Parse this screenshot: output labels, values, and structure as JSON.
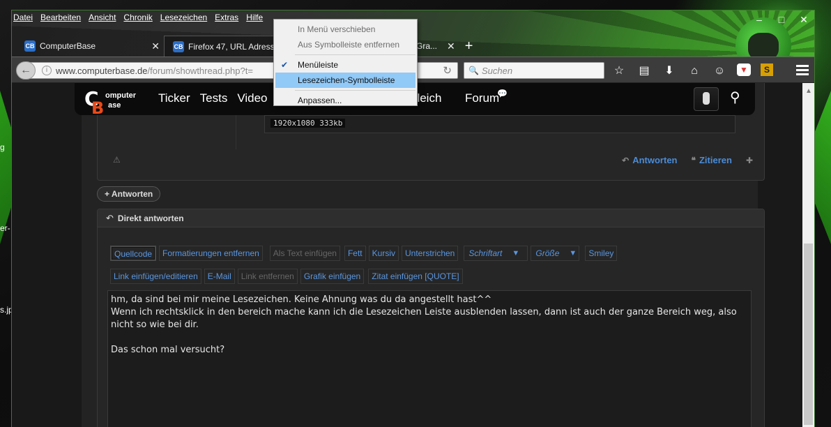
{
  "desktop": {
    "labels": [
      "g",
      "er-",
      "s.jp"
    ]
  },
  "menubar": {
    "items": [
      {
        "label": "Datei",
        "accesskey": "D"
      },
      {
        "label": "Bearbeiten",
        "accesskey": "B"
      },
      {
        "label": "Ansicht",
        "accesskey": "A"
      },
      {
        "label": "Chronik",
        "accesskey": "C"
      },
      {
        "label": "Lesezeichen",
        "accesskey": "L"
      },
      {
        "label": "Extras",
        "accesskey": "E"
      },
      {
        "label": "Hilfe",
        "accesskey": "H"
      }
    ]
  },
  "tabs": [
    {
      "title": "ComputerBase",
      "favicon": "CB"
    },
    {
      "title": "Firefox 47, URL Adressl",
      "favicon": "CB"
    },
    {
      "title": "-Gra..."
    }
  ],
  "window_controls": {
    "minimize": "–",
    "maximize": "□",
    "close": "✕"
  },
  "navbar": {
    "url_host": "www.computerbase.de",
    "url_path": "/forum/showthread.php?t=",
    "search_placeholder": "Suchen",
    "toolbar_icons": [
      "star-icon",
      "reading-list-icon",
      "download-icon",
      "home-icon",
      "emoji-icon",
      "pocket-icon",
      "extension-icon"
    ],
    "extension_label": "S"
  },
  "context_menu": {
    "items": [
      {
        "label": "In Menü verschieben",
        "disabled": true
      },
      {
        "label": "Aus Symbolleiste entfernen",
        "disabled": true
      },
      {
        "label": "Menüleiste",
        "checked": true
      },
      {
        "label": "Lesezeichen-Symbolleiste",
        "highlighted": true
      },
      {
        "label": "Anpassen..."
      }
    ]
  },
  "site": {
    "logo_line1": "omputer",
    "logo_line2": "ase",
    "logo_c": "C",
    "logo_b": "B",
    "nav": [
      "Ticker",
      "Tests",
      "Video"
    ],
    "nav_vergleich": "gleich",
    "nav_forum": "Forum",
    "image_info": "1920x1080 333kb"
  },
  "post": {
    "answer_label": "Antworten",
    "quote_label": "Zitieren"
  },
  "reply_button": "Antworten",
  "direct_reply": {
    "title": "Direkt antworten",
    "toolbar_row1": [
      {
        "label": "Quellcode",
        "state": "active"
      },
      {
        "label": "Formatierungen entfernen"
      },
      {
        "label": "Als Text einfügen",
        "state": "disabled"
      },
      {
        "label": "Fett"
      },
      {
        "label": "Kursiv"
      },
      {
        "label": "Unterstrichen"
      }
    ],
    "font_select": "Schriftart",
    "size_select": "Größe",
    "smiley": "Smiley",
    "toolbar_row2": [
      {
        "label": "Link einfügen/editieren"
      },
      {
        "label": "E-Mail"
      },
      {
        "label": "Link entfernen",
        "state": "disabled"
      },
      {
        "label": "Grafik einfügen"
      },
      {
        "label": "Zitat einfügen [QUOTE]"
      }
    ],
    "text_lines": [
      "hm, da sind bei mir meine Lesezeichen. Keine Ahnung was du da angestellt hast^^",
      "Wenn ich rechtsklick in den bereich mache kann ich die Lesezeichen Leiste ausblenden lassen, dann ist auch der ganze Bereich weg, also nicht so wie bei dir.",
      "",
      "Das schon mal versucht?"
    ]
  },
  "colors": {
    "accent_green": "#3a9a28",
    "link_blue": "#4a8cd8",
    "menu_highlight": "#91c9f7"
  }
}
